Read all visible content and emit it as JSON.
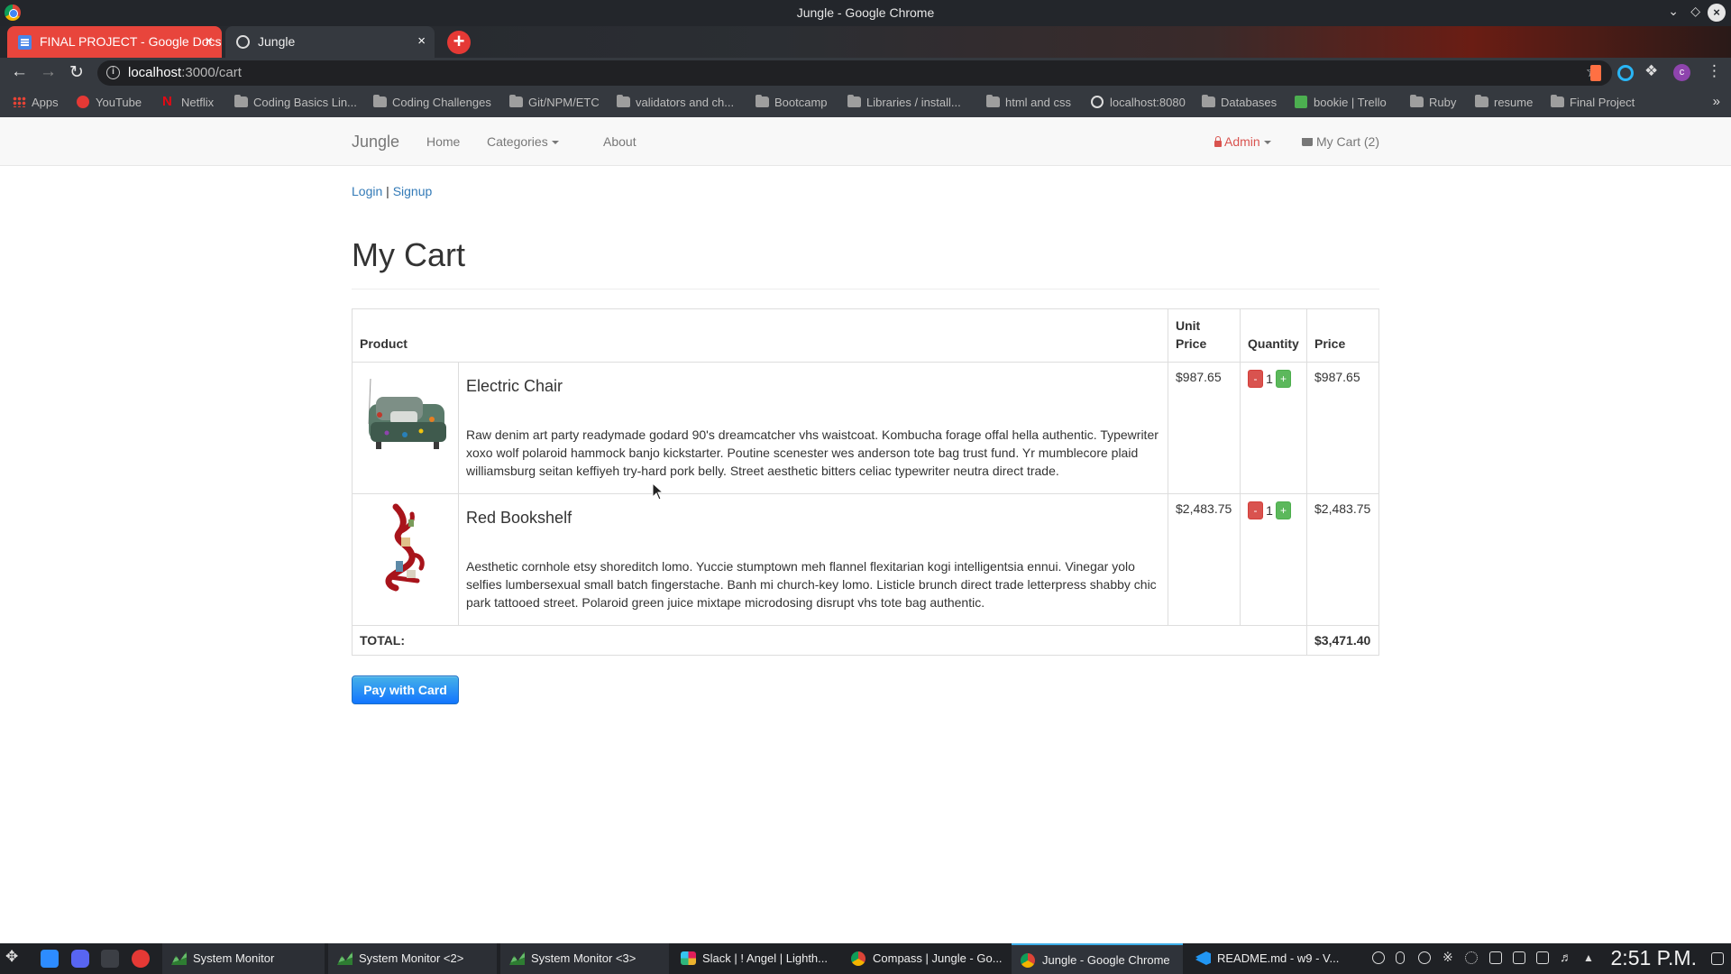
{
  "window": {
    "title": "Jungle - Google Chrome"
  },
  "tabs": [
    {
      "label": "FINAL PROJECT - Google Docs",
      "active": false
    },
    {
      "label": "Jungle",
      "active": true
    }
  ],
  "address_bar": {
    "host": "localhost",
    "path": ":3000/cart"
  },
  "bookmarks": [
    {
      "label": "Apps",
      "icon": "apps-grid-icon"
    },
    {
      "label": "YouTube",
      "icon": "youtube-icon"
    },
    {
      "label": "Netflix",
      "icon": "netflix-icon"
    },
    {
      "label": "Coding Basics Lin...",
      "icon": "folder-icon"
    },
    {
      "label": "Coding Challenges",
      "icon": "folder-icon"
    },
    {
      "label": "Git/NPM/ETC",
      "icon": "folder-icon"
    },
    {
      "label": "validators and ch...",
      "icon": "folder-icon"
    },
    {
      "label": "Bootcamp",
      "icon": "folder-icon"
    },
    {
      "label": "Libraries / install...",
      "icon": "folder-icon"
    },
    {
      "label": "html and css",
      "icon": "folder-icon"
    },
    {
      "label": "localhost:8080",
      "icon": "globe-icon"
    },
    {
      "label": "Databases",
      "icon": "folder-icon"
    },
    {
      "label": "bookie | Trello",
      "icon": "trello-icon"
    },
    {
      "label": "Ruby",
      "icon": "folder-icon"
    },
    {
      "label": "resume",
      "icon": "folder-icon"
    },
    {
      "label": "Final Project",
      "icon": "folder-icon"
    }
  ],
  "navbar": {
    "brand": "Jungle",
    "home": "Home",
    "categories": "Categories",
    "about": "About",
    "admin": "Admin",
    "cart": "My Cart (2)"
  },
  "auth": {
    "login": "Login",
    "separator": "|",
    "signup": "Signup"
  },
  "page": {
    "title": "My Cart"
  },
  "cart_table": {
    "headers": {
      "product": "Product",
      "unit_price": "Unit Price",
      "quantity": "Quantity",
      "price": "Price"
    },
    "items": [
      {
        "name": "Electric Chair",
        "description": "Raw denim art party readymade godard 90's dreamcatcher vhs waistcoat. Kombucha forage offal hella authentic. Typewriter xoxo wolf polaroid hammock banjo kickstarter. Poutine scenester wes anderson tote bag trust fund. Yr mumblecore plaid williamsburg seitan keffiyeh try-hard pork belly. Street aesthetic bitters celiac typewriter neutra direct trade.",
        "unit_price": "$987.65",
        "quantity": "1",
        "price": "$987.65"
      },
      {
        "name": "Red Bookshelf",
        "description": "Aesthetic cornhole etsy shoreditch lomo. Yuccie stumptown meh flannel flexitarian kogi intelligentsia ennui. Vinegar yolo selfies lumbersexual small batch fingerstache. Banh mi church-key lomo. Listicle brunch direct trade letterpress shabby chic park tattooed street. Polaroid green juice mixtape microdosing disrupt vhs tote bag authentic.",
        "unit_price": "$2,483.75",
        "quantity": "1",
        "price": "$2,483.75"
      }
    ],
    "minus_label": "-",
    "plus_label": "+",
    "total_label": "TOTAL:",
    "total_value": "$3,471.40"
  },
  "pay_button": "Pay with Card",
  "taskbar": {
    "tasks": [
      {
        "label": "System Monitor",
        "icon": "system-monitor-icon"
      },
      {
        "label": "System Monitor <2>",
        "icon": "system-monitor-icon"
      },
      {
        "label": "System Monitor <3>",
        "icon": "system-monitor-icon"
      },
      {
        "label": "Slack | ! Angel | Lighth...",
        "icon": "slack-icon"
      },
      {
        "label": "Compass | Jungle - Go...",
        "icon": "chrome-icon"
      },
      {
        "label": "Jungle - Google Chrome",
        "icon": "chrome-icon"
      },
      {
        "label": "README.md - w9 - V...",
        "icon": "vscode-icon"
      }
    ],
    "clock": "2:51 P.M."
  }
}
